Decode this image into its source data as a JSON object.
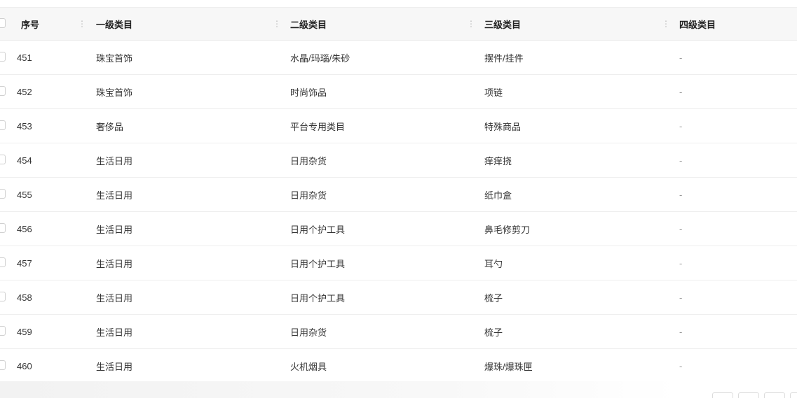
{
  "table": {
    "columns": [
      "序号",
      "一级类目",
      "二级类目",
      "三级类目",
      "四级类目"
    ],
    "rows": [
      {
        "index": "451",
        "level1": "珠宝首饰",
        "level2": "水晶/玛瑙/朱砂",
        "level3": "摆件/挂件",
        "level4": "-"
      },
      {
        "index": "452",
        "level1": "珠宝首饰",
        "level2": "时尚饰品",
        "level3": "项链",
        "level4": "-"
      },
      {
        "index": "453",
        "level1": "奢侈品",
        "level2": "平台专用类目",
        "level3": "特殊商品",
        "level4": "-"
      },
      {
        "index": "454",
        "level1": "生活日用",
        "level2": "日用杂货",
        "level3": "痒痒挠",
        "level4": "-"
      },
      {
        "index": "455",
        "level1": "生活日用",
        "level2": "日用杂货",
        "level3": "纸巾盒",
        "level4": "-"
      },
      {
        "index": "456",
        "level1": "生活日用",
        "level2": "日用个护工具",
        "level3": "鼻毛修剪刀",
        "level4": "-"
      },
      {
        "index": "457",
        "level1": "生活日用",
        "level2": "日用个护工具",
        "level3": "耳勺",
        "level4": "-"
      },
      {
        "index": "458",
        "level1": "生活日用",
        "level2": "日用个护工具",
        "level3": "梳子",
        "level4": "-"
      },
      {
        "index": "459",
        "level1": "生活日用",
        "level2": "日用杂货",
        "level3": "梳子",
        "level4": "-"
      },
      {
        "index": "460",
        "level1": "生活日用",
        "level2": "火机烟具",
        "level3": "爆珠/爆珠匣",
        "level4": "-"
      }
    ]
  },
  "icons": {
    "resize_handle": "column-resize-icon"
  }
}
